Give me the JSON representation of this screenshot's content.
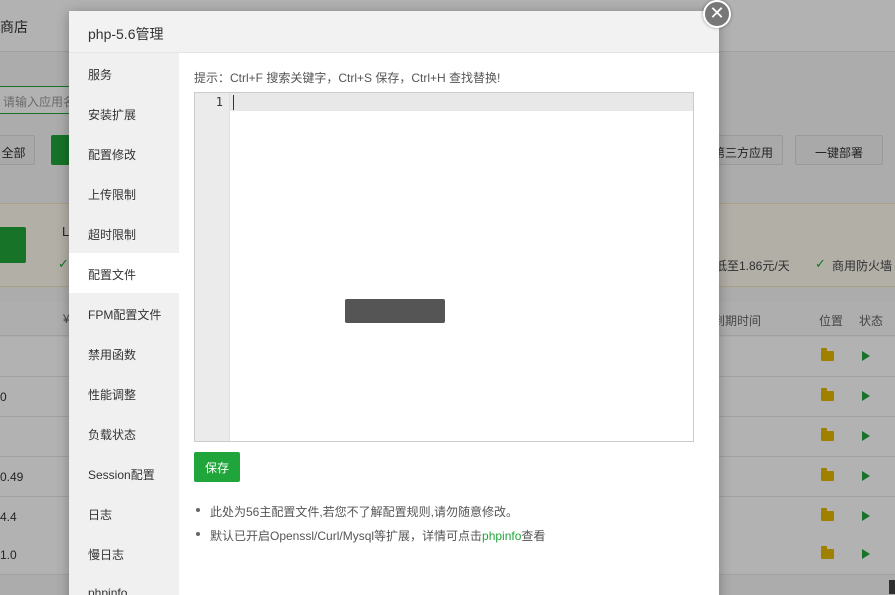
{
  "background": {
    "title": "商店",
    "search_placeholder": "请输入应用名称、字",
    "buttons": {
      "all": "全部",
      "third_party": "第三方应用",
      "deploy": "一键部署"
    },
    "banner": {
      "label": "L",
      "price_text": "低至1.86元/天",
      "firewall_text": "商用防火墙"
    },
    "table_headers": {
      "expire": "到期时间",
      "location": "位置",
      "status": "状态"
    },
    "row_fragments": [
      "",
      "0",
      "",
      "0.49",
      "4.4",
      "1.0"
    ]
  },
  "modal": {
    "title": "php-5.6管理",
    "close_symbol": "✕",
    "sidebar_items": [
      "服务",
      "安装扩展",
      "配置修改",
      "上传限制",
      "超时限制",
      "配置文件",
      "FPM配置文件",
      "禁用函数",
      "性能调整",
      "负载状态",
      "Session配置",
      "日志",
      "慢日志",
      "phpinfo"
    ],
    "active_item": "配置文件",
    "tip": "提示：Ctrl+F 搜索关键字，Ctrl+S 保存，Ctrl+H 查找替换!",
    "editor": {
      "line_number": "1"
    },
    "save_label": "保存",
    "notes": {
      "note1": "此处为56主配置文件,若您不了解配置规则,请勿随意修改。",
      "note2_prefix": "默认已开启Openssl/Curl/Mysql等扩展，详情可点击",
      "note2_link": "phpinfo",
      "note2_suffix": "查看"
    }
  },
  "colors": {
    "accent": "#20a53a"
  },
  "icons": {
    "folder": "folder-icon",
    "play": "play-icon",
    "close": "close-icon"
  }
}
